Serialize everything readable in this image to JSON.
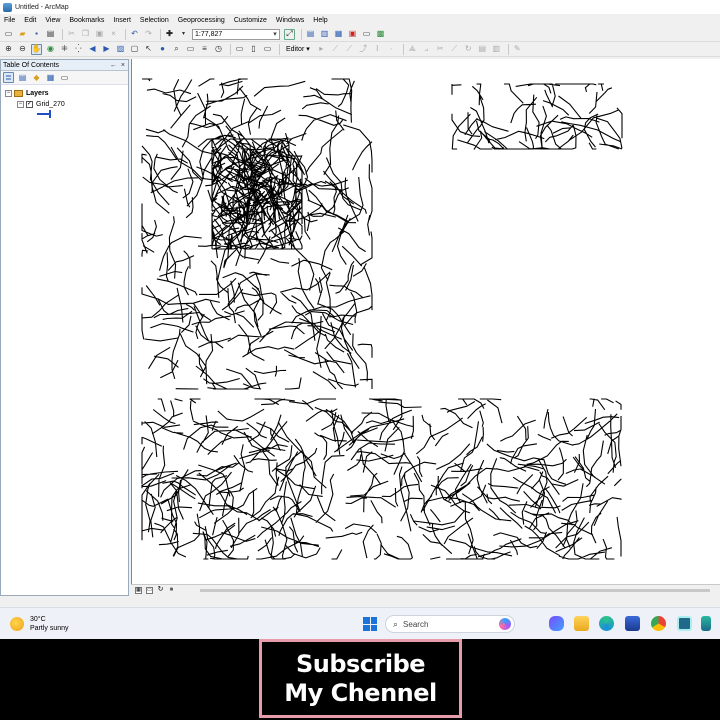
{
  "window": {
    "title": "Untitled - ArcMap"
  },
  "menu": [
    "File",
    "Edit",
    "View",
    "Bookmarks",
    "Insert",
    "Selection",
    "Geoprocessing",
    "Customize",
    "Windows",
    "Help"
  ],
  "toolbar": {
    "scale_value": "1:77,827",
    "editor_label": "Editor"
  },
  "toc": {
    "title": "Table Of Contents",
    "pin_glyph": "←",
    "close_glyph": "×",
    "layers_label": "Layers",
    "layer_name": "Grid_270",
    "layer_checked": true,
    "legend_color": "#1f4fc4"
  },
  "taskbar": {
    "temperature": "30°C",
    "weather_desc": "Partly sunny",
    "search_placeholder": "Search",
    "apps": [
      "copilot-app",
      "file-explorer",
      "edge",
      "store",
      "chrome",
      "arcmap",
      "vpn"
    ]
  },
  "banner": {
    "line1": "Subscribe",
    "line2": "My Chennel",
    "border_color": "#e79ca9"
  }
}
